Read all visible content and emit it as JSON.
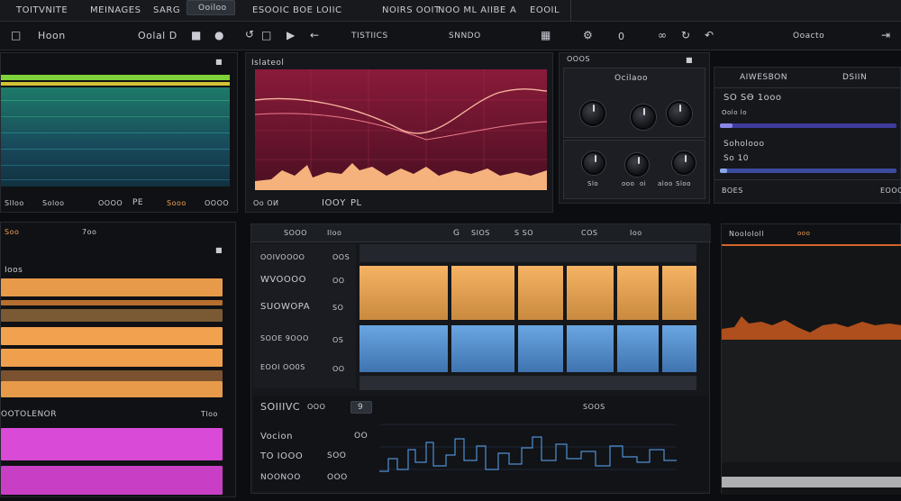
{
  "menubar": {
    "items": [
      "TOITVNITE",
      "MEINAGES",
      "SARG",
      "Ooiloo",
      "ESOOIC BOE LOIIC",
      "NOIRS OOIT",
      "NOO ML AIIBE",
      "A",
      "EOOIL"
    ]
  },
  "toolbar": {
    "home_label": "Hoon",
    "display_label": "Oolal D",
    "section_label": "TISTIICS",
    "mode_label": "SNNDO",
    "count": "0",
    "status_label": "Ooacto"
  },
  "left_top": {
    "header": "",
    "footer_labels": [
      "Slloo",
      "Soloo",
      "OOOO",
      "PE",
      "Sooo",
      "OOOO"
    ]
  },
  "waveform": {
    "title": "Islateol",
    "footer_left": "Oo OИ",
    "footer_mid": "IOOΥ",
    "footer_right": "PL"
  },
  "knobs_panel": {
    "header": "OOOS",
    "title": "Ocilaoo",
    "labels": [
      "Slo",
      "ooo",
      "oi",
      "aloo",
      "Sloo"
    ]
  },
  "params_panel": {
    "header": "AIWESBON",
    "header_right": "DSIIN",
    "rows": [
      {
        "label": "SO SӨ 1ooo",
        "sub": "Oolo lo"
      },
      {
        "label": "Soholooo",
        "sub": "So 10"
      }
    ],
    "footer_left": "BOES",
    "footer_right": "EOOO"
  },
  "left_mid": {
    "header": "7oo",
    "header_left": "Soo",
    "title": "Ioos",
    "footer_label": "OOTOLENOR",
    "footer_right": "Tloo"
  },
  "mixer": {
    "header": [
      "SOOO",
      "Iloo",
      "G",
      "SIOS",
      "S SO",
      "COS",
      "Ioo"
    ],
    "track_labels": [
      "OOIVOOOO",
      "WVOOOO",
      "SUOWOPA",
      "SOOE 9OOO",
      "EOOI OO0S"
    ],
    "track_values": [
      "OOS",
      "OO",
      "SO",
      "OS",
      "OO"
    ],
    "lower_title": "SOIIIVC",
    "lower_tag": "9",
    "lower_mid": "OOO",
    "lower_right": "SOOS",
    "lower_rows": [
      "Vocion",
      "TO IOOO",
      "NOONOO"
    ],
    "lower_values": [
      "OO",
      "SOO",
      "OOO"
    ]
  },
  "right_panel": {
    "header": "Noolololl",
    "header_right": "ooo"
  },
  "chart_colors": {
    "green": "#7ed23a",
    "teal": "#1f8e8a",
    "crimson": "#7b1632",
    "orange": "#f2a24f",
    "blue": "#4f8fd1",
    "magenta": "#d94ad6"
  }
}
